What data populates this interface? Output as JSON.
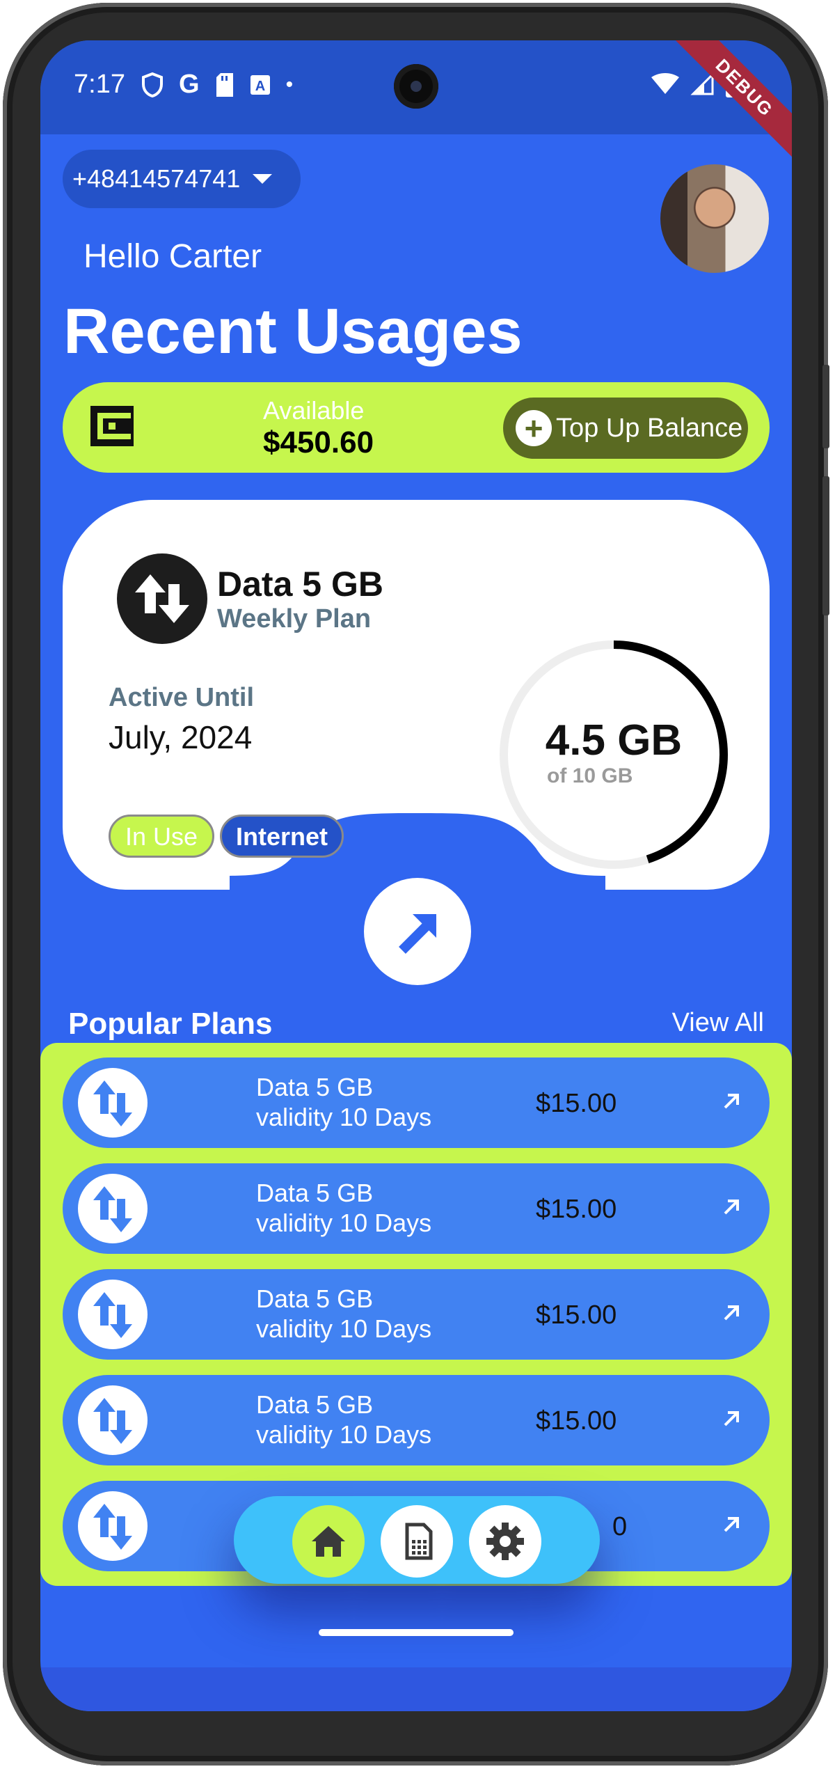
{
  "status": {
    "time": "7:17",
    "debug_label": "DEBUG"
  },
  "header": {
    "phone_number": "+48414574741",
    "greeting": "Hello Carter",
    "title": "Recent Usages"
  },
  "balance": {
    "label": "Available",
    "amount": "$450.60",
    "topup_label": "Top Up Balance"
  },
  "current_plan": {
    "name": "Data 5 GB",
    "period": "Weekly Plan",
    "active_label": "Active Until",
    "active_date": "July, 2024",
    "badges": [
      "In Use",
      "Internet"
    ],
    "used": "4.5 GB",
    "total": "of 10 GB",
    "used_fraction": 0.45
  },
  "popular": {
    "title": "Popular Plans",
    "view_all": "View All",
    "plans": [
      {
        "name": "Data 5 GB",
        "validity": "validity 10 Days",
        "price": "$15.00"
      },
      {
        "name": "Data 5 GB",
        "validity": "validity 10 Days",
        "price": "$15.00"
      },
      {
        "name": "Data 5 GB",
        "validity": "validity 10 Days",
        "price": "$15.00"
      },
      {
        "name": "Data 5 GB",
        "validity": "validity 10 Days",
        "price": "$15.00"
      },
      {
        "name": "",
        "validity": "",
        "price": "0"
      }
    ]
  },
  "nav": {
    "items": [
      "home-icon",
      "sim-card-icon",
      "settings-icon"
    ],
    "active": "home-icon"
  },
  "colors": {
    "background": "#3065f0",
    "accent_lime": "#c6f64d",
    "row_blue": "#4182f2",
    "nav_cyan": "#3ec1fa"
  }
}
